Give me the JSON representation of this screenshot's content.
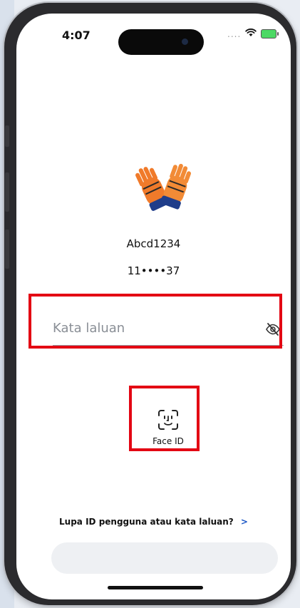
{
  "status_bar": {
    "time": "4:07",
    "signal_dots": "....",
    "wifi_icon": "wifi-icon",
    "battery_icon": "battery-charging-icon"
  },
  "profile": {
    "avatar_icon": "gloves-avatar-icon",
    "username": "Abcd1234",
    "account_masked": "11••••37"
  },
  "password": {
    "placeholder": "Kata laluan",
    "value": "",
    "toggle_icon": "eye-slash-icon"
  },
  "biometric": {
    "icon": "face-id-icon",
    "label": "Face ID"
  },
  "forgot": {
    "label": "Lupa ID pengguna atau kata laluan?",
    "chevron": ">"
  },
  "colors": {
    "highlight": "#e30613",
    "link_chevron": "#1a56c6"
  }
}
